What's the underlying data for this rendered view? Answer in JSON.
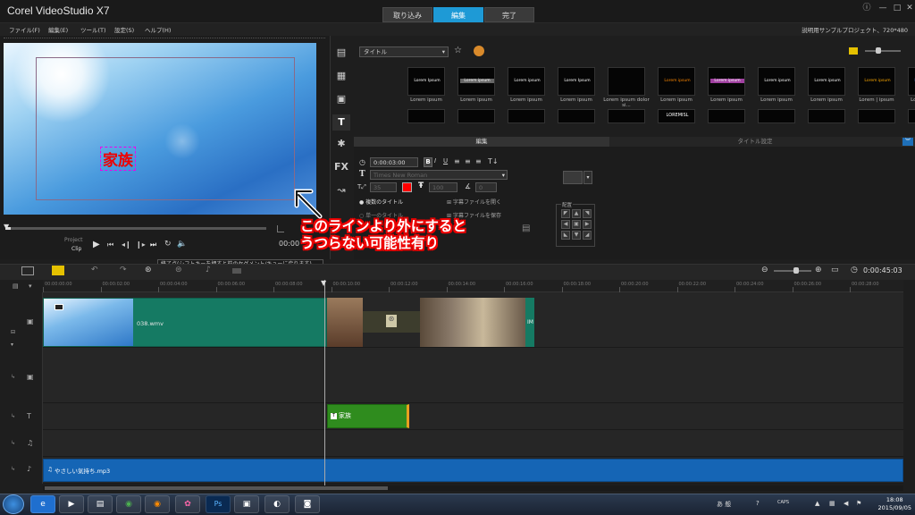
{
  "app": {
    "title": "Corel VideoStudio X7"
  },
  "main_tabs": [
    {
      "label": "取り込み"
    },
    {
      "label": "編集"
    },
    {
      "label": "完了"
    }
  ],
  "menu": [
    "ファイル(F)",
    "編集(E)",
    "ツール(T)",
    "設定(S)",
    "ヘルプ(H)"
  ],
  "project_info": "説明用サンプルプロジェクト、720*480",
  "preview": {
    "title_text": "家族"
  },
  "player": {
    "project_label": "Project",
    "clip_label": "Clip",
    "timecode_partial": "00:00"
  },
  "tooltip": "終了点(シフトキーを押すと前のセグメント/キューに戻ります)",
  "library": {
    "dropdown": "タイトル",
    "row1_captions": [
      "Lorem Ipsum",
      "Lorem ipsum",
      "Lorem ipsum",
      "Lorem Ipsum",
      "",
      "Lorem ipsum",
      "Lorem ipsum",
      "Lorem ipsum",
      "Lorem ipsum",
      "Lorem ipsum",
      "Lorem Ipsum"
    ],
    "row1_labels": [
      "Lorem ipsum",
      "Lorem ipsum",
      "Lorem ipsum",
      "Lorem ipsum",
      "Lorem ipsum dolor si...",
      "Lorem ipsum",
      "Lorem ipsum",
      "Lorem ipsum",
      "Lorem ipsum",
      "Lorem | ipsum",
      "Lorem ipsum"
    ],
    "row2_captions": [
      "",
      "",
      "",
      "",
      "",
      "LOREMISL",
      "",
      "",
      "",
      "",
      ""
    ]
  },
  "options": {
    "tab_edit": "編集",
    "tab_title_settings": "タイトル設定",
    "duration": "0:00:03:00",
    "font": "Times New Roman",
    "font_size": "35",
    "line_spacing": "100",
    "angle": "0",
    "radio_multi": "複数のタイトル",
    "radio_single": "単一のタイトル",
    "open_subtitle": "字幕ファイルを開く",
    "save_subtitle": "字幕ファイルを保存",
    "alignment_label": "配置",
    "text_color": "#ff0000"
  },
  "annotation": {
    "line1": "このラインより外にすると",
    "line2": "うつらない可能性有り"
  },
  "timeline": {
    "timecode": "0:00:45:03",
    "ruler_ticks": [
      "00:00:00:00",
      "00:00:02:00",
      "00:00:04:00",
      "00:00:06:00",
      "00:00:08:00",
      "00:00:10:00",
      "00:00:12:00",
      "00:00:14:00",
      "00:00:16:00",
      "00:00:18:00",
      "00:00:20:00",
      "00:00:22:00",
      "00:00:24:00",
      "00:00:26:00",
      "00:00:28:00"
    ],
    "video_clip_label": "038.wmv",
    "video_clip_end_label": "IM",
    "title_clip_label": "家族",
    "music_clip_label": "やさしい気持ち.mp3"
  },
  "taskbar": {
    "time": "18:08",
    "date": "2015/09/05",
    "ime": "あ 般"
  }
}
